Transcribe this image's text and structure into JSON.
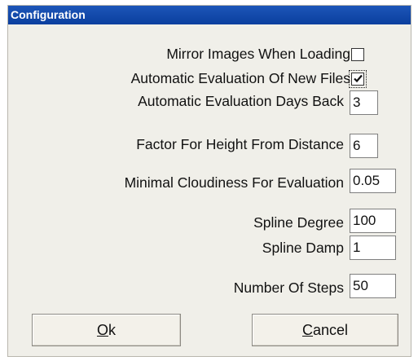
{
  "window": {
    "title": "Configuration"
  },
  "settings": {
    "mirror_images": {
      "label": "Mirror Images When Loading",
      "checked": false
    },
    "auto_eval": {
      "label": "Automatic Evaluation Of New Files",
      "checked": true
    },
    "auto_eval_days": {
      "label": "Automatic Evaluation Days Back",
      "value": "3"
    },
    "height_factor": {
      "label": "Factor For Height From Distance",
      "value": "6"
    },
    "min_cloudiness": {
      "label": "Minimal Cloudiness For Evaluation",
      "value": "0.05"
    },
    "spline_degree": {
      "label": "Spline Degree",
      "value": "100"
    },
    "spline_damp": {
      "label": "Spline Damp",
      "value": "1"
    },
    "num_steps": {
      "label": "Number Of Steps",
      "value": "50"
    }
  },
  "buttons": {
    "ok": {
      "mnemonic": "O",
      "rest": "k"
    },
    "cancel": {
      "mnemonic": "C",
      "rest": "ancel"
    }
  }
}
